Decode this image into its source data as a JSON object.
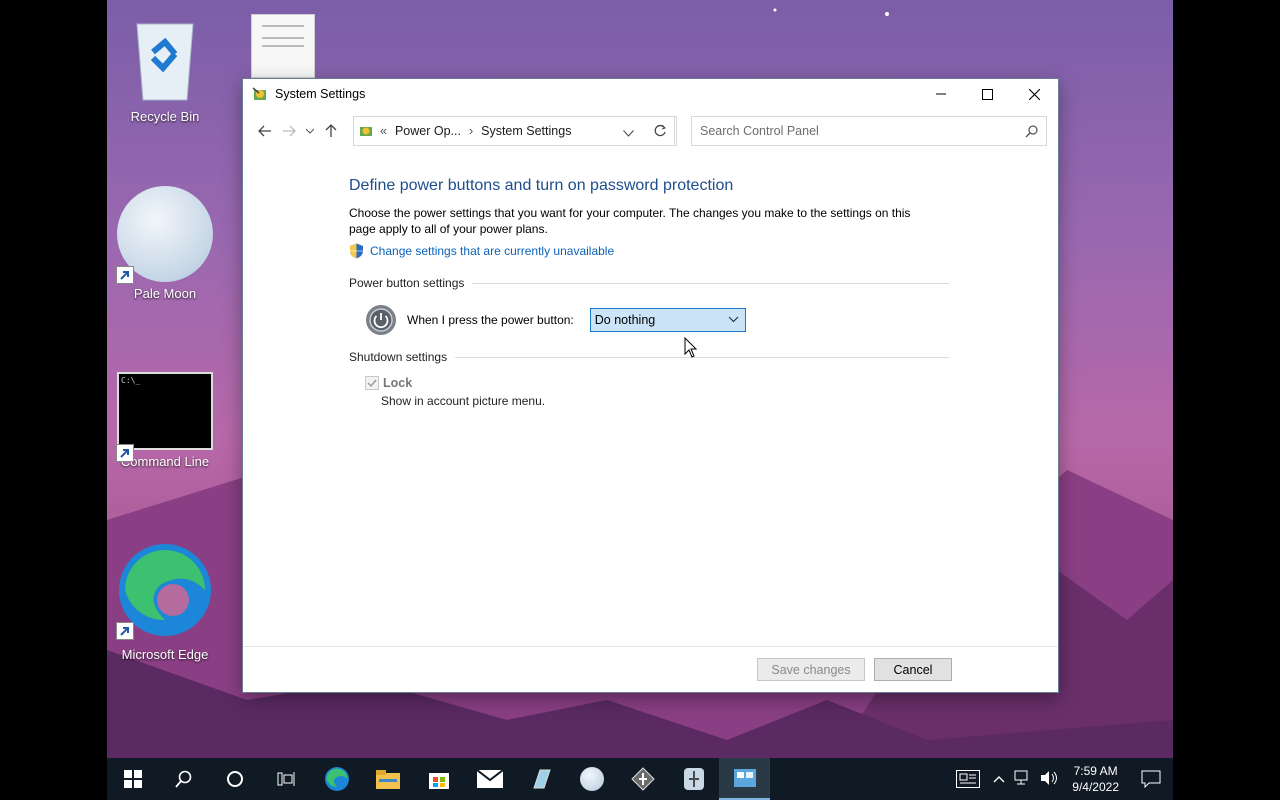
{
  "desktop": {
    "icons": [
      {
        "label": "Recycle Bin",
        "icon": "recycle-bin-icon"
      },
      {
        "label": "Pale Moon",
        "icon": "pale-moon-icon"
      },
      {
        "label": "Command Line",
        "icon": "command-line-icon"
      },
      {
        "label": "Microsoft Edge",
        "icon": "edge-icon"
      }
    ]
  },
  "window": {
    "title": "System Settings",
    "breadcrumb": {
      "prefix": "«",
      "parent": "Power Op...",
      "separator": "›",
      "current": "System Settings"
    },
    "search": {
      "placeholder": "Search Control Panel"
    },
    "heading": "Define power buttons and turn on password protection",
    "description": "Choose the power settings that you want for your computer. The changes you make to the settings on this page apply to all of your power plans.",
    "change_link": "Change settings that are currently unavailable",
    "power_section": {
      "title": "Power button settings",
      "label": "When I press the power button:",
      "selected": "Do nothing"
    },
    "shutdown_section": {
      "title": "Shutdown settings",
      "lock_label": "Lock",
      "lock_checked": true,
      "lock_desc": "Show in account picture menu."
    },
    "buttons": {
      "save": "Save changes",
      "cancel": "Cancel"
    }
  },
  "taskbar": {
    "items": [
      "start-icon",
      "search-icon",
      "cortana-icon",
      "task-view-icon",
      "edge-icon",
      "file-explorer-icon",
      "store-icon",
      "mail-icon",
      "app-icon",
      "pale-moon-icon",
      "app-icon",
      "app-icon",
      "control-panel-icon"
    ],
    "time": "7:59 AM",
    "date": "9/4/2022"
  },
  "colors": {
    "accent": "#1e4e8c",
    "link": "#0b62b9",
    "taskbar": "#101a24"
  }
}
